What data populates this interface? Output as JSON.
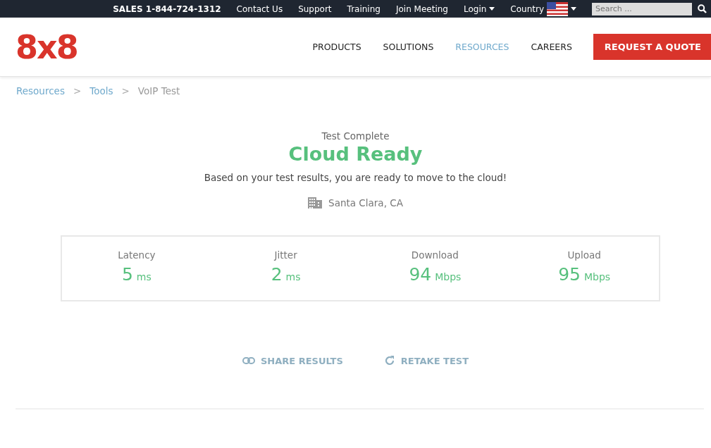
{
  "top_bar": {
    "sales": "SALES 1-844-724-1312",
    "links": [
      {
        "label": "Contact Us",
        "dropdown": false
      },
      {
        "label": "Support",
        "dropdown": false
      },
      {
        "label": "Training",
        "dropdown": false
      },
      {
        "label": "Join Meeting",
        "dropdown": false
      },
      {
        "label": "Login",
        "dropdown": true
      }
    ],
    "country": {
      "label": "Country"
    },
    "search": {
      "placeholder": "Search ..."
    }
  },
  "header": {
    "logo": "8x8",
    "nav": [
      {
        "label": "PRODUCTS",
        "selected": false
      },
      {
        "label": "SOLUTIONS",
        "selected": false
      },
      {
        "label": "RESOURCES",
        "selected": true
      },
      {
        "label": "CAREERS",
        "selected": false
      }
    ],
    "cta": "REQUEST A QUOTE"
  },
  "breadcrumb": {
    "separator": ">",
    "items": [
      {
        "label": "Resources",
        "current": false
      },
      {
        "label": "Tools",
        "current": false
      },
      {
        "label": "VoIP Test",
        "current": true
      }
    ]
  },
  "result": {
    "status": "Test Complete",
    "headline": "Cloud Ready",
    "message": "Based on your test results, you are ready to move to the cloud!",
    "location": "Santa Clara, CA"
  },
  "metrics": [
    {
      "label": "Latency",
      "value": "5",
      "unit": "ms"
    },
    {
      "label": "Jitter",
      "value": "2",
      "unit": "ms"
    },
    {
      "label": "Download",
      "value": "94",
      "unit": "Mbps"
    },
    {
      "label": "Upload",
      "value": "95",
      "unit": "Mbps"
    }
  ],
  "actions": [
    {
      "kind": "share",
      "label": "SHARE RESULTS"
    },
    {
      "kind": "retake",
      "label": "RETAKE TEST"
    }
  ]
}
